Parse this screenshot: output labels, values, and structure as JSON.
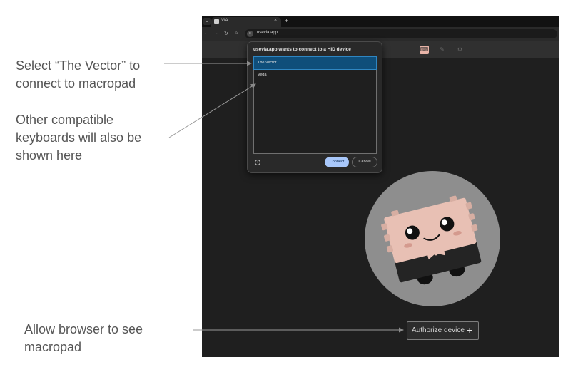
{
  "annotations": [
    {
      "lines": [
        "Select “The Vector” to",
        "connect to macropad"
      ]
    },
    {
      "lines": [
        "Other compatible",
        "keyboards will also be",
        "shown here"
      ]
    },
    {
      "lines": [
        "Allow browser to see",
        "macropad"
      ]
    }
  ],
  "browser": {
    "tab_title": "VIA",
    "tab_close": "×",
    "tab_new": "+",
    "url": "usevia.app"
  },
  "dialog": {
    "title": "usevia.app wants to connect to a HID device",
    "devices": [
      "The Vector",
      "Vega"
    ],
    "selected_device": "The Vector",
    "connect_label": "Connect",
    "cancel_label": "Cancel"
  },
  "authorize": {
    "label": "Authorize device",
    "plus": "+"
  },
  "colors": {
    "annotation_text": "#555555",
    "browser_bg": "#1f1f1f",
    "selected_device_bg": "#0f4e7a",
    "connect_button": "#a8c7fa",
    "mascot_circle": "#8e8e8e",
    "mascot_body": "#e8c0b4"
  },
  "icons": {
    "toolbar": [
      "keyboard-icon",
      "brush-icon",
      "gear-icon"
    ],
    "dialog_help": "help-icon",
    "nav": [
      "back-arrow-icon",
      "forward-arrow-icon",
      "reload-icon",
      "home-icon"
    ]
  }
}
